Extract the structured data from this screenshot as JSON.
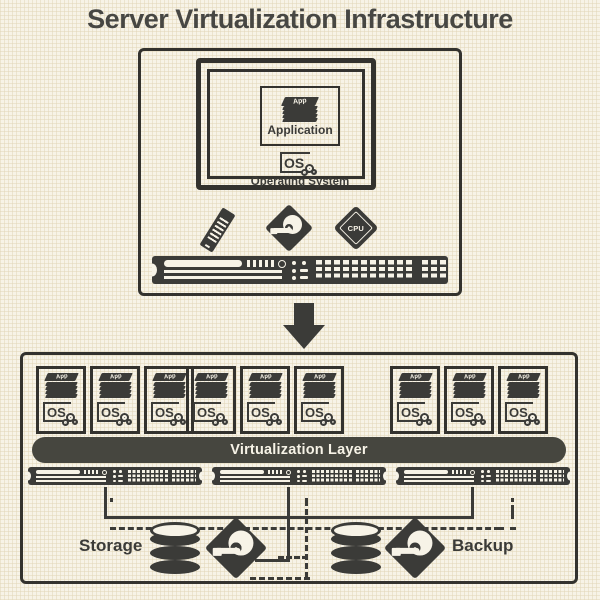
{
  "title": "Server Virtualization Infrastructure",
  "colors": {
    "background": "#f7f3e7",
    "ink": "#3b3b38",
    "outline": "#33322e",
    "layer_bar": "#46463f",
    "layer_text": "#f7f3e7"
  },
  "physical_server": {
    "vm_screen": {
      "application": {
        "label": "Application",
        "icon": "app-stack-icon",
        "stack_text": "App"
      },
      "operating_system": {
        "label": "Operating System",
        "icon": "os-gear-icon",
        "badge": "OS"
      }
    },
    "hardware": [
      {
        "name": "memory",
        "icon": "ram-stick-icon",
        "label": ""
      },
      {
        "name": "hard-disk",
        "icon": "hard-disk-icon",
        "label": ""
      },
      {
        "name": "processor",
        "icon": "cpu-chip-icon",
        "label": "CPU"
      }
    ],
    "rack_unit": {
      "icon": "server-rack-icon"
    }
  },
  "transition": {
    "icon": "down-arrow-icon"
  },
  "virtualized": {
    "layer_label": "Virtualization Layer",
    "vm_groups": [
      {
        "group": 1,
        "vms": [
          {
            "app_label": "App",
            "os_label": "OS"
          },
          {
            "app_label": "App",
            "os_label": "OS"
          },
          {
            "app_label": "App",
            "os_label": "OS"
          }
        ]
      },
      {
        "group": 2,
        "vms": [
          {
            "app_label": "App",
            "os_label": "OS"
          },
          {
            "app_label": "App",
            "os_label": "OS"
          },
          {
            "app_label": "App",
            "os_label": "OS"
          }
        ]
      },
      {
        "group": 3,
        "vms": [
          {
            "app_label": "App",
            "os_label": "OS"
          },
          {
            "app_label": "App",
            "os_label": "OS"
          },
          {
            "app_label": "App",
            "os_label": "OS"
          }
        ]
      }
    ],
    "host_servers": [
      {
        "icon": "server-rack-icon"
      },
      {
        "icon": "server-rack-icon"
      },
      {
        "icon": "server-rack-icon"
      }
    ]
  },
  "bottom": {
    "storage_label": "Storage",
    "backup_label": "Backup",
    "storage_icons": [
      {
        "name": "database-cylinder-icon"
      },
      {
        "name": "hard-disk-icon"
      }
    ],
    "backup_icons": [
      {
        "name": "database-cylinder-icon"
      },
      {
        "name": "hard-disk-icon"
      }
    ]
  }
}
